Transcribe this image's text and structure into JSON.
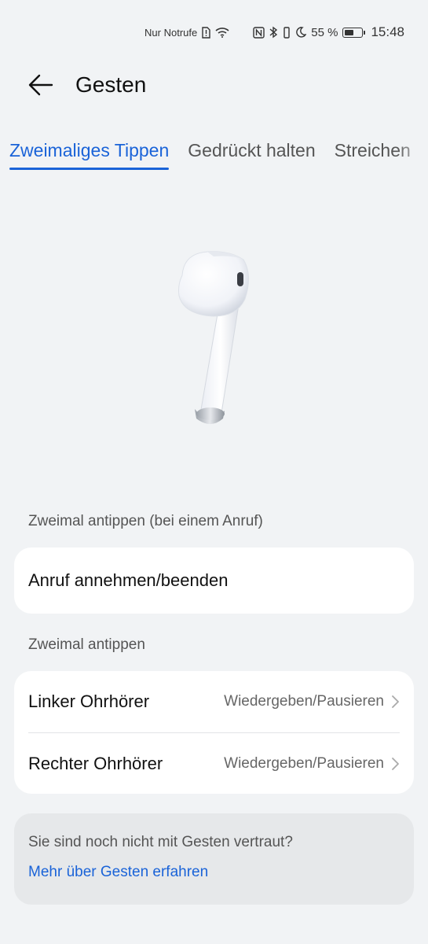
{
  "status_bar": {
    "carrier": "Nur Notrufe",
    "battery_percent": "55 %",
    "battery_level": 0.55,
    "time": "15:48",
    "icons": [
      "sim-alert-icon",
      "wifi-icon",
      "nfc-icon",
      "bluetooth-icon",
      "vibrate-icon",
      "moon-icon",
      "battery-icon"
    ]
  },
  "header": {
    "title": "Gesten",
    "back_icon": "arrow-left-icon"
  },
  "tabs": [
    {
      "label": "Zweimaliges Tippen",
      "active": true
    },
    {
      "label": "Gedrückt halten",
      "active": false
    },
    {
      "label": "Streichen",
      "active": false
    }
  ],
  "call_section": {
    "label": "Zweimal antippen (bei einem Anruf)",
    "item": "Anruf annehmen/beenden"
  },
  "tap_section": {
    "label": "Zweimal antippen",
    "rows": [
      {
        "title": "Linker Ohrhörer",
        "value": "Wiedergeben/Pausieren"
      },
      {
        "title": "Rechter Ohrhörer",
        "value": "Wiedergeben/Pausieren"
      }
    ]
  },
  "info": {
    "text": "Sie sind noch nicht mit Gesten vertraut?",
    "link": "Mehr über Gesten erfahren"
  },
  "colors": {
    "accent": "#1a63d8",
    "background": "#f1f3f5",
    "card": "#ffffff"
  }
}
